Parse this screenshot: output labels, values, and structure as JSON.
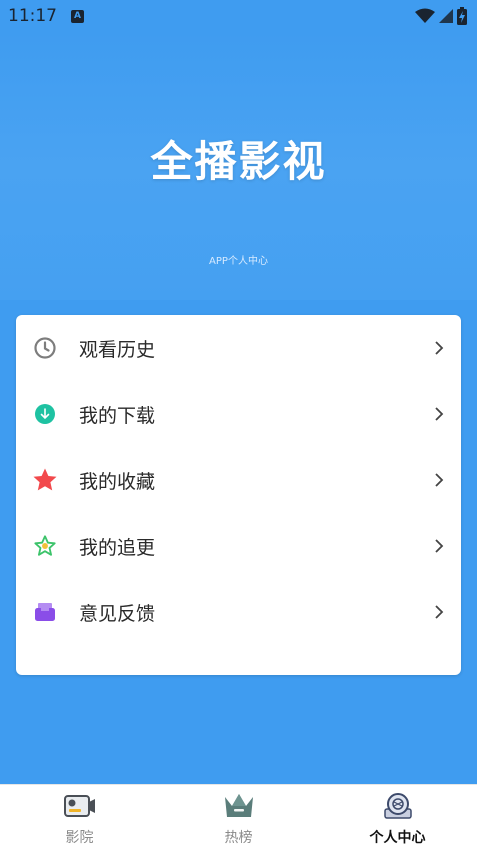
{
  "status_bar": {
    "time": "11:17",
    "notification_icon": "a-icon",
    "icons": [
      "wifi-icon",
      "signal-icon",
      "battery-charging-icon"
    ]
  },
  "header": {
    "title": "全播影视",
    "subtitle": "APP个人中心"
  },
  "menu": {
    "items": [
      {
        "label": "观看历史",
        "icon": "clock-icon",
        "color": "#7d7d7d"
      },
      {
        "label": "我的下载",
        "icon": "download-icon",
        "color": "#1ec2a2"
      },
      {
        "label": "我的收藏",
        "icon": "star-icon",
        "color": "#f2494c"
      },
      {
        "label": "我的追更",
        "icon": "star-outline-icon",
        "color": "#3cc36a"
      },
      {
        "label": "意见反馈",
        "icon": "inbox-icon",
        "color": "#8a4de8"
      }
    ]
  },
  "tabbar": {
    "tabs": [
      {
        "label": "影院",
        "icon": "camera-icon",
        "active": false
      },
      {
        "label": "热榜",
        "icon": "crown-icon",
        "active": false
      },
      {
        "label": "个人中心",
        "icon": "profile-icon",
        "active": true
      }
    ]
  },
  "colors": {
    "primary": "#3f9cf0",
    "card": "#ffffff"
  }
}
